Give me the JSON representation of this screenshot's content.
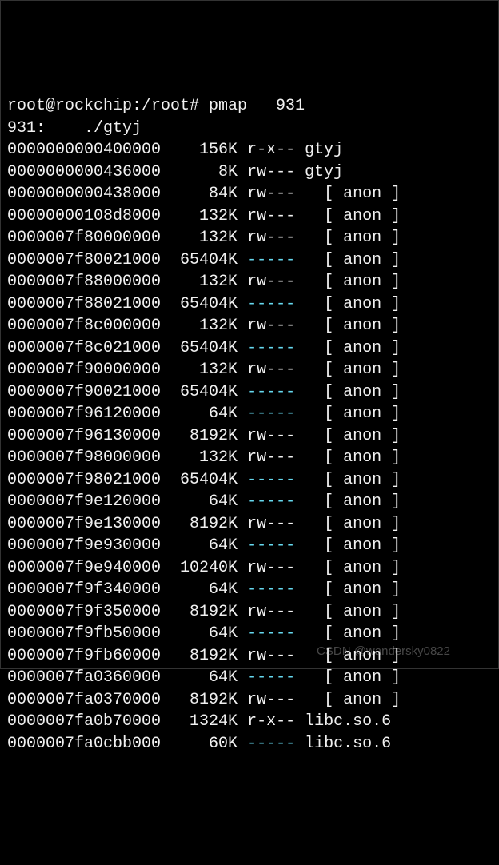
{
  "prompt": "root@rockchip:/root# pmap   931",
  "header": "931:    ./gtyj",
  "rows": [
    {
      "addr": "0000000000400000",
      "size": "156K",
      "perm": "r-x--",
      "map": "gtyj",
      "anon": false
    },
    {
      "addr": "0000000000436000",
      "size": "8K",
      "perm": "rw---",
      "map": "gtyj",
      "anon": false
    },
    {
      "addr": "0000000000438000",
      "size": "84K",
      "perm": "rw---",
      "map": "anon",
      "anon": true
    },
    {
      "addr": "00000000108d8000",
      "size": "132K",
      "perm": "rw---",
      "map": "anon",
      "anon": true
    },
    {
      "addr": "0000007f80000000",
      "size": "132K",
      "perm": "rw---",
      "map": "anon",
      "anon": true
    },
    {
      "addr": "0000007f80021000",
      "size": "65404K",
      "perm": "-----",
      "map": "anon",
      "anon": true
    },
    {
      "addr": "0000007f88000000",
      "size": "132K",
      "perm": "rw---",
      "map": "anon",
      "anon": true
    },
    {
      "addr": "0000007f88021000",
      "size": "65404K",
      "perm": "-----",
      "map": "anon",
      "anon": true
    },
    {
      "addr": "0000007f8c000000",
      "size": "132K",
      "perm": "rw---",
      "map": "anon",
      "anon": true
    },
    {
      "addr": "0000007f8c021000",
      "size": "65404K",
      "perm": "-----",
      "map": "anon",
      "anon": true
    },
    {
      "addr": "0000007f90000000",
      "size": "132K",
      "perm": "rw---",
      "map": "anon",
      "anon": true
    },
    {
      "addr": "0000007f90021000",
      "size": "65404K",
      "perm": "-----",
      "map": "anon",
      "anon": true
    },
    {
      "addr": "0000007f96120000",
      "size": "64K",
      "perm": "-----",
      "map": "anon",
      "anon": true
    },
    {
      "addr": "0000007f96130000",
      "size": "8192K",
      "perm": "rw---",
      "map": "anon",
      "anon": true
    },
    {
      "addr": "0000007f98000000",
      "size": "132K",
      "perm": "rw---",
      "map": "anon",
      "anon": true
    },
    {
      "addr": "0000007f98021000",
      "size": "65404K",
      "perm": "-----",
      "map": "anon",
      "anon": true
    },
    {
      "addr": "0000007f9e120000",
      "size": "64K",
      "perm": "-----",
      "map": "anon",
      "anon": true
    },
    {
      "addr": "0000007f9e130000",
      "size": "8192K",
      "perm": "rw---",
      "map": "anon",
      "anon": true
    },
    {
      "addr": "0000007f9e930000",
      "size": "64K",
      "perm": "-----",
      "map": "anon",
      "anon": true
    },
    {
      "addr": "0000007f9e940000",
      "size": "10240K",
      "perm": "rw---",
      "map": "anon",
      "anon": true
    },
    {
      "addr": "0000007f9f340000",
      "size": "64K",
      "perm": "-----",
      "map": "anon",
      "anon": true
    },
    {
      "addr": "0000007f9f350000",
      "size": "8192K",
      "perm": "rw---",
      "map": "anon",
      "anon": true
    },
    {
      "addr": "0000007f9fb50000",
      "size": "64K",
      "perm": "-----",
      "map": "anon",
      "anon": true
    },
    {
      "addr": "0000007f9fb60000",
      "size": "8192K",
      "perm": "rw---",
      "map": "anon",
      "anon": true
    },
    {
      "addr": "0000007fa0360000",
      "size": "64K",
      "perm": "-----",
      "map": "anon",
      "anon": true
    },
    {
      "addr": "0000007fa0370000",
      "size": "8192K",
      "perm": "rw---",
      "map": "anon",
      "anon": true
    },
    {
      "addr": "0000007fa0b70000",
      "size": "1324K",
      "perm": "r-x--",
      "map": "libc.so.6",
      "anon": false
    },
    {
      "addr": "0000007fa0cbb000",
      "size": "60K",
      "perm": "-----",
      "map": "libc.so.6",
      "anon": false
    }
  ],
  "watermark": "CSDN @wandersky0822"
}
